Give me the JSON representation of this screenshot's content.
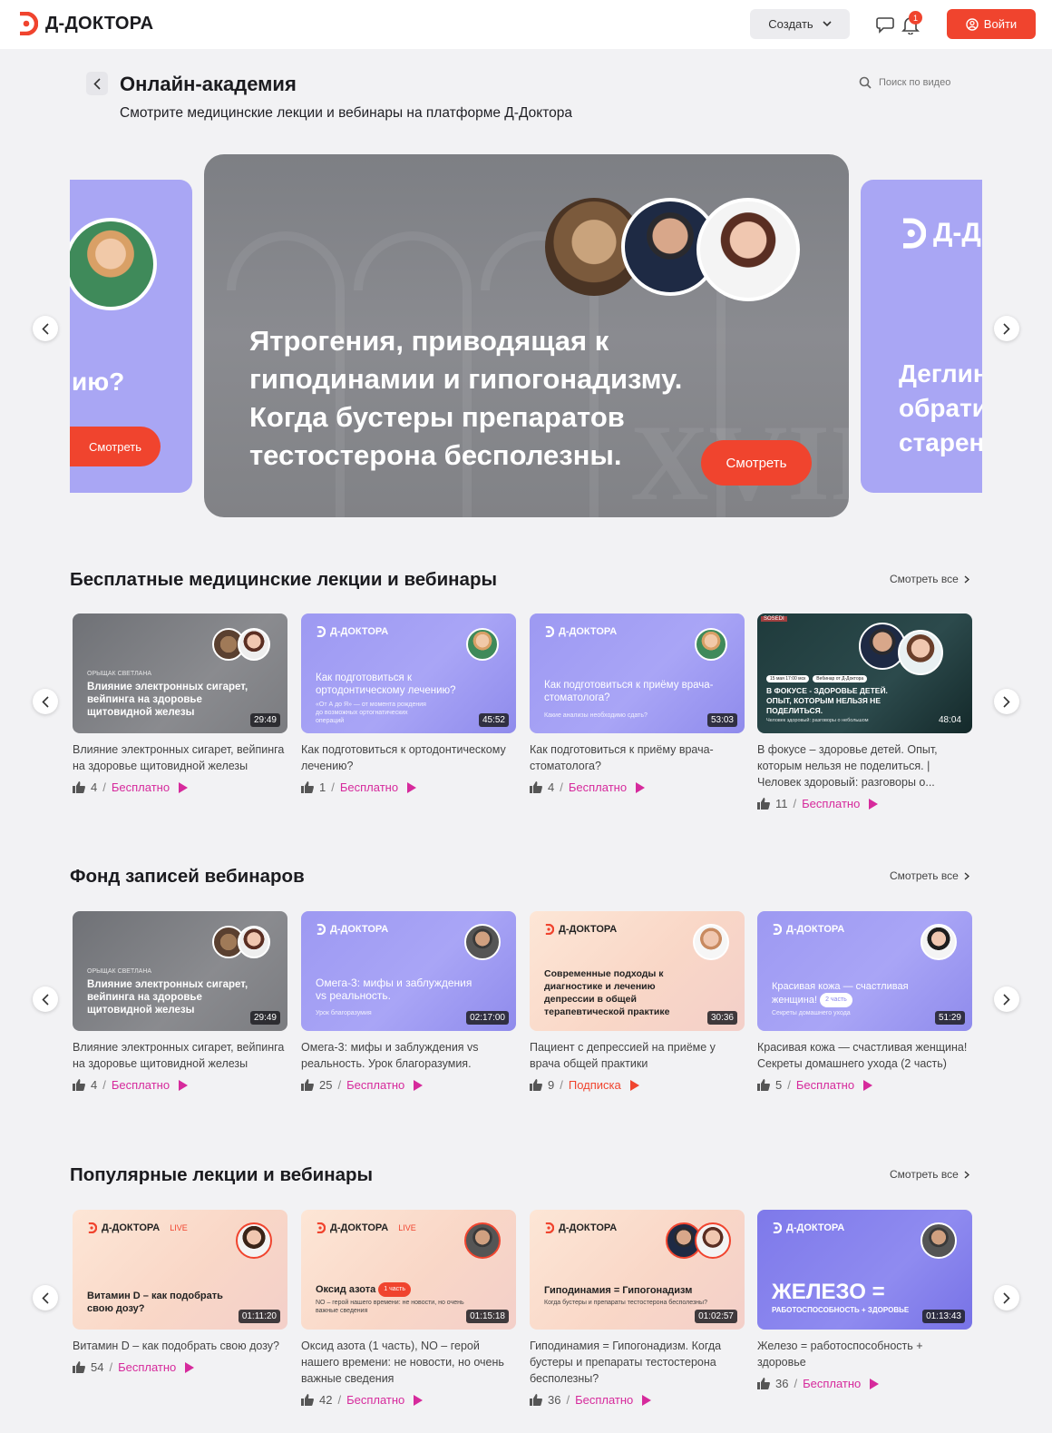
{
  "header": {
    "logo_text": "Д-ДОКТОРА",
    "create_label": "Создать",
    "notifications_count": "1",
    "login_label": "Войти"
  },
  "page": {
    "title": "Онлайн-академия",
    "subtitle": "Смотрите медицинские лекции и вебинары на платформе Д-Доктора",
    "search_placeholder": "Поиск по видео"
  },
  "hero": {
    "left_slide": {
      "title_fragment": "ию?",
      "button": "Смотреть"
    },
    "main_slide": {
      "title": "Ятрогения, приводящая к гиподинамии и гипогонадизму. Когда бустеры препаратов тестостерона бесполезны.",
      "button": "Смотреть"
    },
    "right_slide": {
      "brand_fragment": "Д-Д",
      "title_fragment": "Деглин обрати старен"
    }
  },
  "sections": [
    {
      "title": "Бесплатные медицинские лекции и вебинары",
      "see_all": "Смотреть все",
      "cards": [
        {
          "style": "gray",
          "pre": "ОРЫЩАК СВЕТЛАНА",
          "thumb_text": "Влияние электронных сигарет, вейпинга на здоровье щитовидной железы",
          "duration": "29:49",
          "title": "Влияние электронных сигарет, вейпинга на здоровье щитовидной железы",
          "likes": "4",
          "price": "Бесплатно"
        },
        {
          "style": "purple",
          "brand": "Д-ДОКТОРА",
          "thumb_text": "Как подготовиться к ортодонтическому лечению?",
          "thumb_small": "«От А до Я» — от момента рождения до возможных ортогнатических операций",
          "duration": "45:52",
          "title": "Как подготовиться к ортодонтическому лечению?",
          "likes": "1",
          "price": "Бесплатно"
        },
        {
          "style": "purple",
          "brand": "Д-ДОКТОРА",
          "thumb_text": "Как подготовиться к приёму врача-стоматолога?",
          "thumb_small": "Какие анализы необходимо сдать?",
          "duration": "53:03",
          "title": "Как подготовиться к приёму врача-стоматолога?",
          "likes": "4",
          "price": "Бесплатно"
        },
        {
          "style": "dark",
          "badge": "SOSEDI",
          "tag_a": "15 мая 17:00 мск",
          "tag_b": "Вебинар от Д-Доктора",
          "thumb_text": "В ФОКУСЕ - ЗДОРОВЬЕ ДЕТЕЙ. ОПЫТ, КОТОРЫМ НЕЛЬЗЯ НЕ ПОДЕЛИТЬСЯ.",
          "thumb_small": "Человек здоровый: разговоры о небольшом",
          "duration": "48:04",
          "title": "В фокусе – здоровье детей. Опыт, которым нельзя не поделиться. | Человек здоровый: разговоры о...",
          "likes": "11",
          "price": "Бесплатно"
        }
      ]
    },
    {
      "title": "Фонд записей вебинаров",
      "see_all": "Смотреть все",
      "cards": [
        {
          "style": "gray",
          "pre": "ОРЫЩАК СВЕТЛАНА",
          "thumb_text": "Влияние электронных сигарет, вейпинга на здоровье щитовидной железы",
          "duration": "29:49",
          "title": "Влияние электронных сигарет, вейпинга на здоровье щитовидной железы",
          "likes": "4",
          "price": "Бесплатно"
        },
        {
          "style": "purple",
          "brand": "Д-ДОКТОРА",
          "thumb_text": "Омега-3: мифы и заблуждения vs реальность.",
          "thumb_small": "Урок благоразумия",
          "duration": "02:17:00",
          "title": "Омега-3: мифы и заблуждения vs реальность. Урок благоразумия.",
          "likes": "25",
          "price": "Бесплатно"
        },
        {
          "style": "peach",
          "brand": "Д-ДОКТОРА",
          "thumb_text": "Современные подходы к диагностике и лечению депрессии в общей терапевтической практике",
          "duration": "30:36",
          "title": "Пациент с депрессией на приёме у врача общей практики",
          "likes": "9",
          "price": "Подписка"
        },
        {
          "style": "purple",
          "brand": "Д-ДОКТОРА",
          "thumb_text": "Красивая кожа — счастливая женщина!",
          "thumb_tag": "2 часть",
          "thumb_small": "Секреты домашнего ухода",
          "duration": "51:29",
          "title": "Красивая кожа — счастливая женщина! Секреты домашнего ухода (2 часть)",
          "likes": "5",
          "price": "Бесплатно"
        }
      ]
    },
    {
      "title": "Популярные лекции и вебинары",
      "see_all": "Смотреть все",
      "cards": [
        {
          "style": "peach",
          "brand": "Д-ДОКТОРА",
          "live": "LIVE",
          "thumb_text": "Витамин D – как подобрать свою дозу?",
          "duration": "01:11:20",
          "title": "Витамин D – как подобрать свою дозу?",
          "likes": "54",
          "price": "Бесплатно"
        },
        {
          "style": "peach",
          "brand": "Д-ДОКТОРА",
          "live": "LIVE",
          "thumb_text": "Оксид азота",
          "thumb_tag": "1 часть",
          "thumb_small": "NO – герой нашего времени: не новости, но очень важные сведения",
          "duration": "01:15:18",
          "title": "Оксид азота (1 часть), NO – герой нашего времени: не новости, но очень важные сведения",
          "likes": "42",
          "price": "Бесплатно"
        },
        {
          "style": "peach",
          "brand": "Д-ДОКТОРА",
          "thumb_text": "Гиподинамия = Гипогонадизм",
          "thumb_small": "Когда бустеры и препараты тестостерона бесполезны?",
          "duration": "01:02:57",
          "title": "Гиподинамия = Гипогонадизм. Когда бустеры и препараты тестостерона бесполезны?",
          "likes": "36",
          "price": "Бесплатно"
        },
        {
          "style": "purple",
          "brand": "Д-ДОКТОРА",
          "thumb_big": "ЖЕЛЕЗО =",
          "thumb_small": "РАБОТОСПОСОБНОСТЬ + ЗДОРОВЬЕ",
          "duration": "01:13:43",
          "title": "Железо = работоспособность + здоровье",
          "likes": "36",
          "price": "Бесплатно"
        }
      ]
    }
  ],
  "colors": {
    "accent": "#f0442e",
    "price": "#d62a9c",
    "purple": "#a9a6f4"
  },
  "icons": [
    "logo-icon",
    "chevron-down-icon",
    "chat-icon",
    "bell-icon",
    "user-icon",
    "chevron-left-icon",
    "search-icon",
    "chevron-right-icon",
    "thumbs-up-icon",
    "play-icon"
  ]
}
